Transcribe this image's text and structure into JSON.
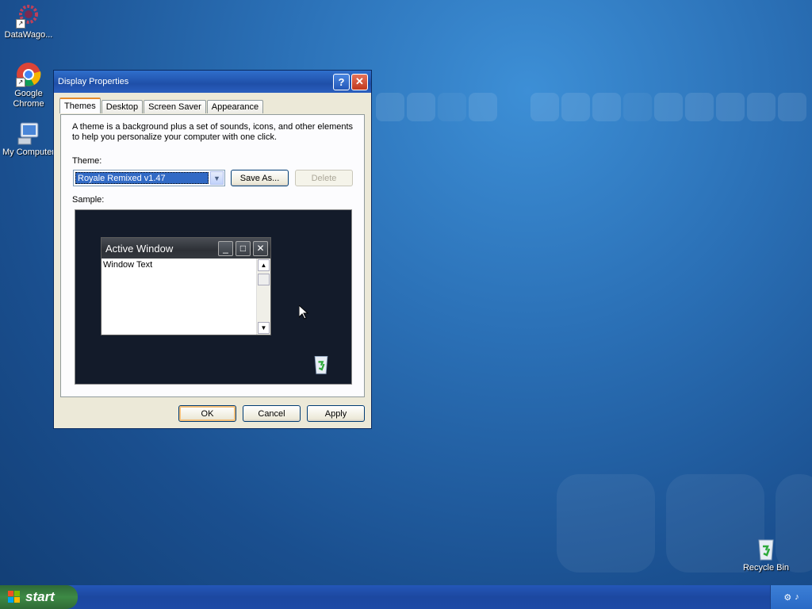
{
  "desktop": {
    "icons": [
      {
        "label": "DataWago..."
      },
      {
        "label": "Google Chrome"
      },
      {
        "label": "My Computer"
      },
      {
        "label": "Recycle Bin"
      }
    ]
  },
  "dialog": {
    "title": "Display Properties",
    "help_label": "?",
    "close_label": "✕",
    "tabs": [
      {
        "label": "Themes"
      },
      {
        "label": "Desktop"
      },
      {
        "label": "Screen Saver"
      },
      {
        "label": "Appearance"
      }
    ],
    "description": "A theme is a background plus a set of sounds, icons, and other elements to help you personalize your computer with one click.",
    "theme_label": "Theme:",
    "theme_value": "Royale Remixed v1.47",
    "save_as_label": "Save As...",
    "delete_label": "Delete",
    "sample_label": "Sample:",
    "sample": {
      "window_title": "Active Window",
      "window_text": "Window Text"
    },
    "ok_label": "OK",
    "cancel_label": "Cancel",
    "apply_label": "Apply"
  },
  "taskbar": {
    "start_label": "start"
  }
}
